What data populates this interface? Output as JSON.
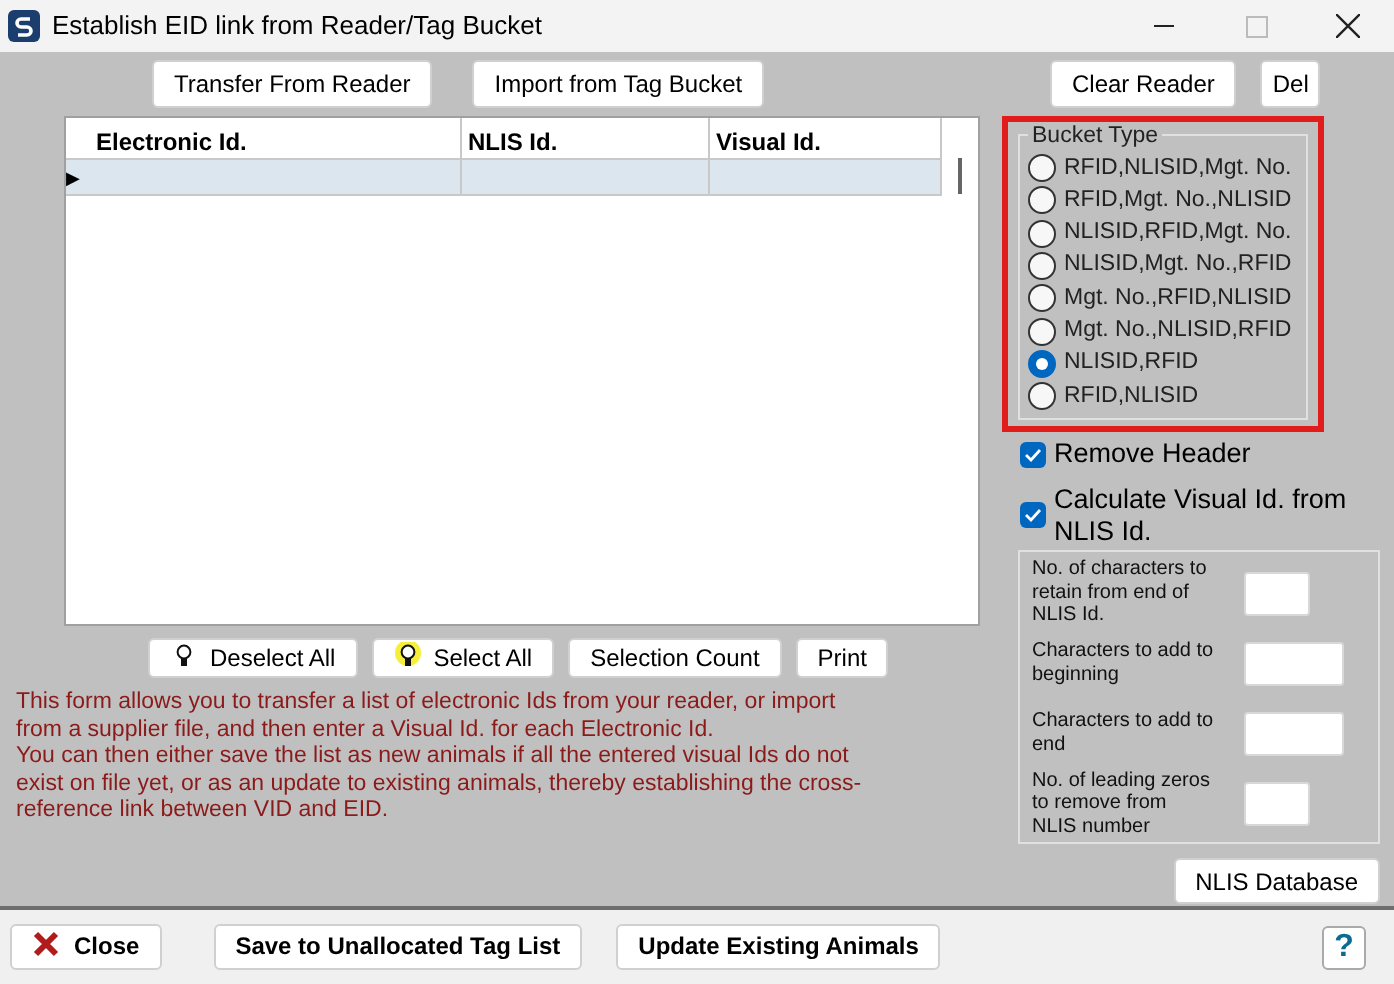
{
  "window": {
    "title": "Establish EID link from Reader/Tag Bucket"
  },
  "top_buttons": [
    {
      "label": "Transfer From Reader"
    },
    {
      "label": "Import from Tag Bucket"
    }
  ],
  "right_buttons": [
    {
      "label": "Clear Reader"
    },
    {
      "label": "Del"
    }
  ],
  "table": {
    "columns": [
      "Electronic Id.",
      "NLIS Id.",
      "Visual Id."
    ],
    "current_row_marker": "▶"
  },
  "list_buttons": [
    {
      "label": "Deselect All",
      "kind": "bulb"
    },
    {
      "label": "Select All",
      "kind": "lit-bulb"
    },
    {
      "label": "Selection Count",
      "kind": "plain"
    },
    {
      "label": "Print",
      "kind": "plain"
    }
  ],
  "help_text": [
    "This form allows you to transfer a list of electronic Ids from your reader, or import from a supplier file, and then enter a Visual Id. for each Electronic Id.",
    "You can then either save the list as new animals if all the entered visual Ids do not exist on file yet, or as an update to existing animals, thereby establishing the cross-reference link between VID and EID."
  ],
  "bucket_type": {
    "title": "Bucket Type",
    "highlighted": true,
    "options": [
      {
        "label": "RFID,NLISID,Mgt. No.",
        "selected": false
      },
      {
        "label": "RFID,Mgt. No.,NLISID",
        "selected": false
      },
      {
        "label": "NLISID,RFID,Mgt. No.",
        "selected": false
      },
      {
        "label": "NLISID,Mgt. No.,RFID",
        "selected": false
      },
      {
        "label": "Mgt. No.,RFID,NLISID",
        "selected": false
      },
      {
        "label": "Mgt. No.,NLISID,RFID",
        "selected": false
      },
      {
        "label": "NLISID,RFID",
        "selected": true
      },
      {
        "label": "RFID,NLISID",
        "selected": false
      }
    ]
  },
  "checkboxes": [
    {
      "label": "Remove Header",
      "checked": true
    },
    {
      "label": "Calculate Visual Id. from NLIS Id.",
      "checked": true
    }
  ],
  "visual_id_settings": [
    {
      "label": "No. of characters to retain from end of NLIS Id."
    },
    {
      "label": "Characters to add to beginning"
    },
    {
      "label": "Characters to add to end"
    },
    {
      "label": "No. of leading zeros to remove from NLIS number"
    }
  ],
  "nlis_button": {
    "label": "NLIS Database"
  },
  "bottom_buttons": [
    {
      "label": "Close",
      "kind": "close"
    },
    {
      "label": "Save to Unallocated Tag List",
      "kind": "plain"
    },
    {
      "label": "Update Existing Animals",
      "kind": "plain"
    }
  ],
  "help_button": {
    "label": "?"
  }
}
